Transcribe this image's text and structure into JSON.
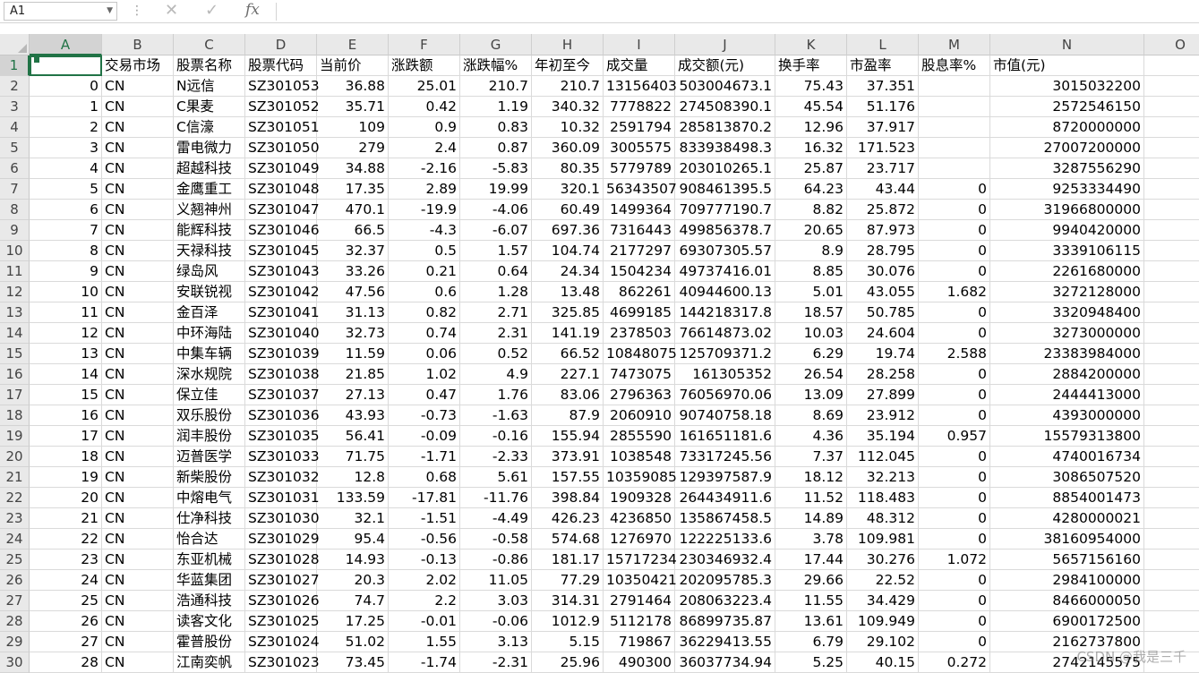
{
  "formula_bar": {
    "name_box": "A1",
    "cancel_icon": "close-icon",
    "enter_icon": "check-icon",
    "fx_label": "fx",
    "formula": ""
  },
  "columns": [
    "A",
    "B",
    "C",
    "D",
    "E",
    "F",
    "G",
    "H",
    "I",
    "J",
    "K",
    "L",
    "M",
    "N",
    "O"
  ],
  "active_cell": "A1",
  "rows": [
    {
      "n": "1",
      "c": [
        "",
        "交易市场",
        "股票名称",
        "股票代码",
        "当前价",
        "涨跌额",
        "涨跌幅%",
        "年初至今",
        "成交量",
        "成交额(元)",
        "换手率",
        "市盈率",
        "股息率%",
        "市值(元)",
        ""
      ]
    },
    {
      "n": "2",
      "c": [
        "0",
        "CN",
        "N远信",
        "SZ301053",
        "36.88",
        "25.01",
        "210.7",
        "210.7",
        "13156403",
        "503004673.1",
        "75.43",
        "37.351",
        "",
        "3015032200",
        ""
      ]
    },
    {
      "n": "3",
      "c": [
        "1",
        "CN",
        "C果麦",
        "SZ301052",
        "35.71",
        "0.42",
        "1.19",
        "340.32",
        "7778822",
        "274508390.1",
        "45.54",
        "51.176",
        "",
        "2572546150",
        ""
      ]
    },
    {
      "n": "4",
      "c": [
        "2",
        "CN",
        "C信濠",
        "SZ301051",
        "109",
        "0.9",
        "0.83",
        "10.32",
        "2591794",
        "285813870.2",
        "12.96",
        "37.917",
        "",
        "8720000000",
        ""
      ]
    },
    {
      "n": "5",
      "c": [
        "3",
        "CN",
        "雷电微力",
        "SZ301050",
        "279",
        "2.4",
        "0.87",
        "360.09",
        "3005575",
        "833938498.3",
        "16.32",
        "171.523",
        "",
        "27007200000",
        ""
      ]
    },
    {
      "n": "6",
      "c": [
        "4",
        "CN",
        "超越科技",
        "SZ301049",
        "34.88",
        "-2.16",
        "-5.83",
        "80.35",
        "5779789",
        "203010265.1",
        "25.87",
        "23.717",
        "",
        "3287556290",
        ""
      ]
    },
    {
      "n": "7",
      "c": [
        "5",
        "CN",
        "金鹰重工",
        "SZ301048",
        "17.35",
        "2.89",
        "19.99",
        "320.1",
        "56343507",
        "908461395.5",
        "64.23",
        "43.44",
        "0",
        "9253334490",
        ""
      ]
    },
    {
      "n": "8",
      "c": [
        "6",
        "CN",
        "义翘神州",
        "SZ301047",
        "470.1",
        "-19.9",
        "-4.06",
        "60.49",
        "1499364",
        "709777190.7",
        "8.82",
        "25.872",
        "0",
        "31966800000",
        ""
      ]
    },
    {
      "n": "9",
      "c": [
        "7",
        "CN",
        "能辉科技",
        "SZ301046",
        "66.5",
        "-4.3",
        "-6.07",
        "697.36",
        "7316443",
        "499856378.7",
        "20.65",
        "87.973",
        "0",
        "9940420000",
        ""
      ]
    },
    {
      "n": "10",
      "c": [
        "8",
        "CN",
        "天禄科技",
        "SZ301045",
        "32.37",
        "0.5",
        "1.57",
        "104.74",
        "2177297",
        "69307305.57",
        "8.9",
        "28.795",
        "0",
        "3339106115",
        ""
      ]
    },
    {
      "n": "11",
      "c": [
        "9",
        "CN",
        "绿岛风",
        "SZ301043",
        "33.26",
        "0.21",
        "0.64",
        "24.34",
        "1504234",
        "49737416.01",
        "8.85",
        "30.076",
        "0",
        "2261680000",
        ""
      ]
    },
    {
      "n": "12",
      "c": [
        "10",
        "CN",
        "安联锐视",
        "SZ301042",
        "47.56",
        "0.6",
        "1.28",
        "13.48",
        "862261",
        "40944600.13",
        "5.01",
        "43.055",
        "1.682",
        "3272128000",
        ""
      ]
    },
    {
      "n": "13",
      "c": [
        "11",
        "CN",
        "金百泽",
        "SZ301041",
        "31.13",
        "0.82",
        "2.71",
        "325.85",
        "4699185",
        "144218317.8",
        "18.57",
        "50.785",
        "0",
        "3320948400",
        ""
      ]
    },
    {
      "n": "14",
      "c": [
        "12",
        "CN",
        "中环海陆",
        "SZ301040",
        "32.73",
        "0.74",
        "2.31",
        "141.19",
        "2378503",
        "76614873.02",
        "10.03",
        "24.604",
        "0",
        "3273000000",
        ""
      ]
    },
    {
      "n": "15",
      "c": [
        "13",
        "CN",
        "中集车辆",
        "SZ301039",
        "11.59",
        "0.06",
        "0.52",
        "66.52",
        "10848075",
        "125709371.2",
        "6.29",
        "19.74",
        "2.588",
        "23383984000",
        ""
      ]
    },
    {
      "n": "16",
      "c": [
        "14",
        "CN",
        "深水规院",
        "SZ301038",
        "21.85",
        "1.02",
        "4.9",
        "227.1",
        "7473075",
        "161305352",
        "26.54",
        "28.258",
        "0",
        "2884200000",
        ""
      ]
    },
    {
      "n": "17",
      "c": [
        "15",
        "CN",
        "保立佳",
        "SZ301037",
        "27.13",
        "0.47",
        "1.76",
        "83.06",
        "2796363",
        "76056970.06",
        "13.09",
        "27.899",
        "0",
        "2444413000",
        ""
      ]
    },
    {
      "n": "18",
      "c": [
        "16",
        "CN",
        "双乐股份",
        "SZ301036",
        "43.93",
        "-0.73",
        "-1.63",
        "87.9",
        "2060910",
        "90740758.18",
        "8.69",
        "23.912",
        "0",
        "4393000000",
        ""
      ]
    },
    {
      "n": "19",
      "c": [
        "17",
        "CN",
        "润丰股份",
        "SZ301035",
        "56.41",
        "-0.09",
        "-0.16",
        "155.94",
        "2855590",
        "161651181.6",
        "4.36",
        "35.194",
        "0.957",
        "15579313800",
        ""
      ]
    },
    {
      "n": "20",
      "c": [
        "18",
        "CN",
        "迈普医学",
        "SZ301033",
        "71.75",
        "-1.71",
        "-2.33",
        "373.91",
        "1038548",
        "73317245.56",
        "7.37",
        "112.045",
        "0",
        "4740016734",
        ""
      ]
    },
    {
      "n": "21",
      "c": [
        "19",
        "CN",
        "新柴股份",
        "SZ301032",
        "12.8",
        "0.68",
        "5.61",
        "157.55",
        "10359085",
        "129397587.9",
        "18.12",
        "32.213",
        "0",
        "3086507520",
        ""
      ]
    },
    {
      "n": "22",
      "c": [
        "20",
        "CN",
        "中熔电气",
        "SZ301031",
        "133.59",
        "-17.81",
        "-11.76",
        "398.84",
        "1909328",
        "264434911.6",
        "11.52",
        "118.483",
        "0",
        "8854001473",
        ""
      ]
    },
    {
      "n": "23",
      "c": [
        "21",
        "CN",
        "仕净科技",
        "SZ301030",
        "32.1",
        "-1.51",
        "-4.49",
        "426.23",
        "4236850",
        "135867458.5",
        "14.89",
        "48.312",
        "0",
        "4280000021",
        ""
      ]
    },
    {
      "n": "24",
      "c": [
        "22",
        "CN",
        "怡合达",
        "SZ301029",
        "95.4",
        "-0.56",
        "-0.58",
        "574.68",
        "1276970",
        "122225133.6",
        "3.78",
        "109.981",
        "0",
        "38160954000",
        ""
      ]
    },
    {
      "n": "25",
      "c": [
        "23",
        "CN",
        "东亚机械",
        "SZ301028",
        "14.93",
        "-0.13",
        "-0.86",
        "181.17",
        "15717234",
        "230346932.4",
        "17.44",
        "30.276",
        "1.072",
        "5657156160",
        ""
      ]
    },
    {
      "n": "26",
      "c": [
        "24",
        "CN",
        "华蓝集团",
        "SZ301027",
        "20.3",
        "2.02",
        "11.05",
        "77.29",
        "10350421",
        "202095785.3",
        "29.66",
        "22.52",
        "0",
        "2984100000",
        ""
      ]
    },
    {
      "n": "27",
      "c": [
        "25",
        "CN",
        "浩通科技",
        "SZ301026",
        "74.7",
        "2.2",
        "3.03",
        "314.31",
        "2791464",
        "208063223.4",
        "11.55",
        "34.429",
        "0",
        "8466000050",
        ""
      ]
    },
    {
      "n": "28",
      "c": [
        "26",
        "CN",
        "读客文化",
        "SZ301025",
        "17.25",
        "-0.01",
        "-0.06",
        "1012.9",
        "5112178",
        "86899735.87",
        "13.61",
        "109.949",
        "0",
        "6900172500",
        ""
      ]
    },
    {
      "n": "29",
      "c": [
        "27",
        "CN",
        "霍普股份",
        "SZ301024",
        "51.02",
        "1.55",
        "3.13",
        "5.15",
        "719867",
        "36229413.55",
        "6.79",
        "29.102",
        "0",
        "2162737800",
        ""
      ]
    },
    {
      "n": "30",
      "c": [
        "28",
        "CN",
        "江南奕帆",
        "SZ301023",
        "73.45",
        "-1.74",
        "-2.31",
        "25.96",
        "490300",
        "36037734.94",
        "5.25",
        "40.15",
        "0.272",
        "2742145575",
        ""
      ]
    }
  ],
  "watermark": "CSDN @我是三千"
}
